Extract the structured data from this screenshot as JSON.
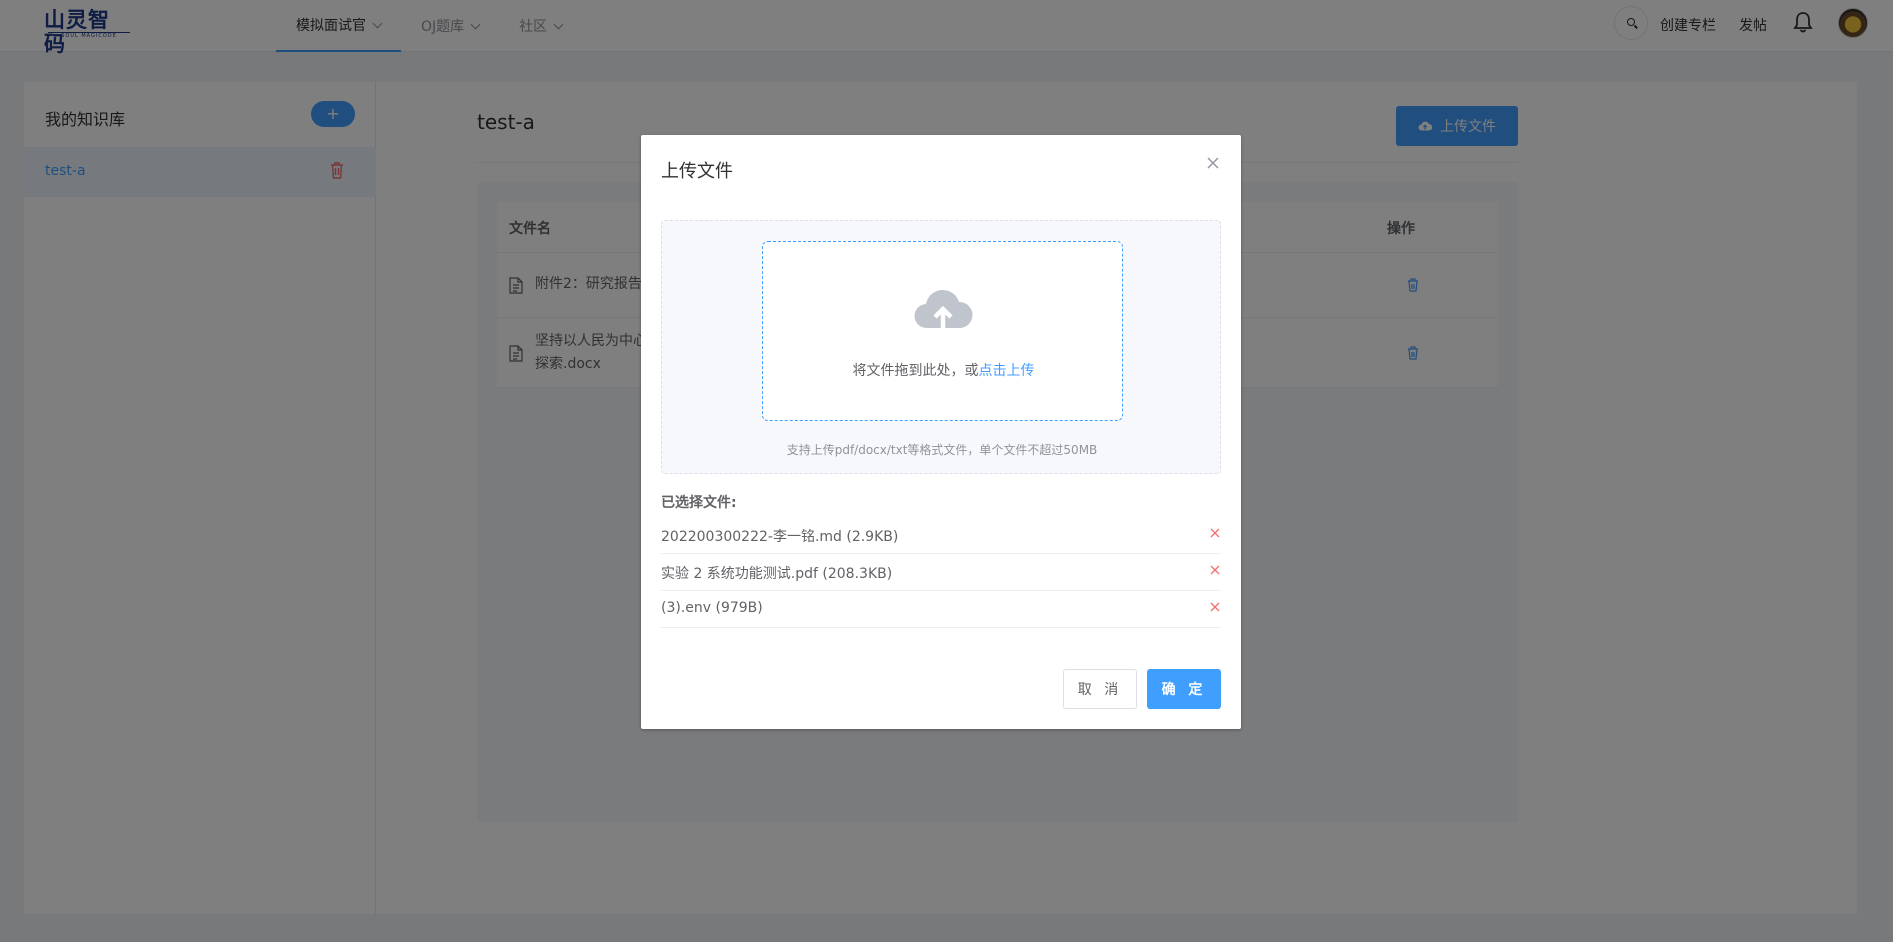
{
  "brand": {
    "name": "山灵智码",
    "subtitle": "SOUL MAGICODE"
  },
  "nav": {
    "items": [
      {
        "label": "模拟面试官"
      },
      {
        "label": "OJ题库"
      },
      {
        "label": "社区"
      }
    ]
  },
  "top": {
    "create_column": "创建专栏",
    "post": "发帖"
  },
  "sidebar": {
    "title": "我的知识库",
    "add_label": "+",
    "kb_name": "test-a"
  },
  "content": {
    "title": "test-a",
    "upload_button": "上传文件",
    "columns": {
      "file_name": "文件名",
      "actions": "操作"
    },
    "rows": [
      {
        "name": "附件2：研究报告"
      },
      {
        "name": "坚持以人民为中心探索.docx"
      }
    ]
  },
  "dialog": {
    "title": "上传文件",
    "drop_text": "将文件拖到此处，或",
    "drop_link": "点击上传",
    "tip": "支持上传pdf/docx/txt等格式文件，单个文件不超过50MB",
    "selected_label": "已选择文件:",
    "files": [
      {
        "name": "202200300222-李一铭.md (2.9KB)"
      },
      {
        "name": "实验 2 系统功能测试.pdf (208.3KB)"
      },
      {
        "name": "(3).env (979B)"
      }
    ],
    "cancel": "取 消",
    "confirm": "确 定"
  },
  "colors": {
    "primary": "#409eff",
    "danger": "#f56c6c",
    "mask": "rgba(0,0,0,0.5)"
  }
}
